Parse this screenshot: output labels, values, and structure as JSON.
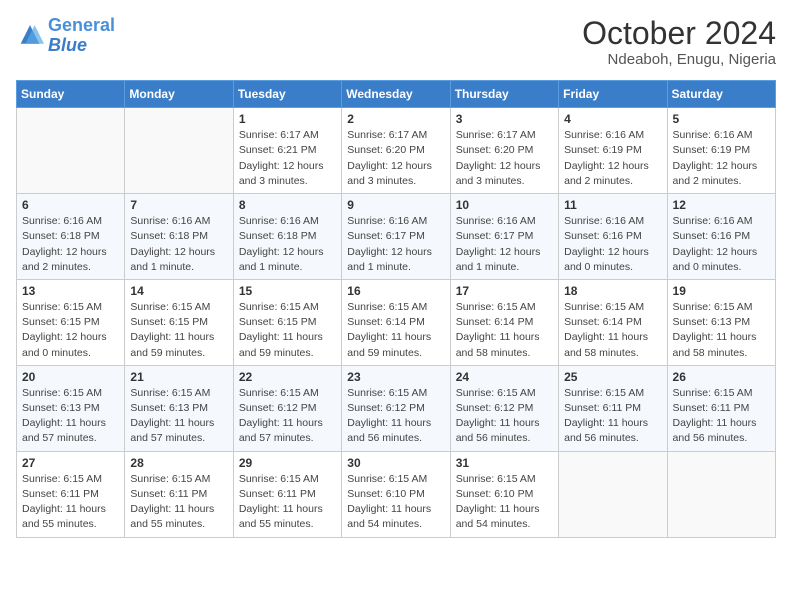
{
  "header": {
    "logo_line1": "General",
    "logo_line2": "Blue",
    "title": "October 2024",
    "subtitle": "Ndeaboh, Enugu, Nigeria"
  },
  "weekdays": [
    "Sunday",
    "Monday",
    "Tuesday",
    "Wednesday",
    "Thursday",
    "Friday",
    "Saturday"
  ],
  "weeks": [
    [
      {
        "day": "",
        "info": ""
      },
      {
        "day": "",
        "info": ""
      },
      {
        "day": "1",
        "info": "Sunrise: 6:17 AM\nSunset: 6:21 PM\nDaylight: 12 hours\nand 3 minutes."
      },
      {
        "day": "2",
        "info": "Sunrise: 6:17 AM\nSunset: 6:20 PM\nDaylight: 12 hours\nand 3 minutes."
      },
      {
        "day": "3",
        "info": "Sunrise: 6:17 AM\nSunset: 6:20 PM\nDaylight: 12 hours\nand 3 minutes."
      },
      {
        "day": "4",
        "info": "Sunrise: 6:16 AM\nSunset: 6:19 PM\nDaylight: 12 hours\nand 2 minutes."
      },
      {
        "day": "5",
        "info": "Sunrise: 6:16 AM\nSunset: 6:19 PM\nDaylight: 12 hours\nand 2 minutes."
      }
    ],
    [
      {
        "day": "6",
        "info": "Sunrise: 6:16 AM\nSunset: 6:18 PM\nDaylight: 12 hours\nand 2 minutes."
      },
      {
        "day": "7",
        "info": "Sunrise: 6:16 AM\nSunset: 6:18 PM\nDaylight: 12 hours\nand 1 minute."
      },
      {
        "day": "8",
        "info": "Sunrise: 6:16 AM\nSunset: 6:18 PM\nDaylight: 12 hours\nand 1 minute."
      },
      {
        "day": "9",
        "info": "Sunrise: 6:16 AM\nSunset: 6:17 PM\nDaylight: 12 hours\nand 1 minute."
      },
      {
        "day": "10",
        "info": "Sunrise: 6:16 AM\nSunset: 6:17 PM\nDaylight: 12 hours\nand 1 minute."
      },
      {
        "day": "11",
        "info": "Sunrise: 6:16 AM\nSunset: 6:16 PM\nDaylight: 12 hours\nand 0 minutes."
      },
      {
        "day": "12",
        "info": "Sunrise: 6:16 AM\nSunset: 6:16 PM\nDaylight: 12 hours\nand 0 minutes."
      }
    ],
    [
      {
        "day": "13",
        "info": "Sunrise: 6:15 AM\nSunset: 6:15 PM\nDaylight: 12 hours\nand 0 minutes."
      },
      {
        "day": "14",
        "info": "Sunrise: 6:15 AM\nSunset: 6:15 PM\nDaylight: 11 hours\nand 59 minutes."
      },
      {
        "day": "15",
        "info": "Sunrise: 6:15 AM\nSunset: 6:15 PM\nDaylight: 11 hours\nand 59 minutes."
      },
      {
        "day": "16",
        "info": "Sunrise: 6:15 AM\nSunset: 6:14 PM\nDaylight: 11 hours\nand 59 minutes."
      },
      {
        "day": "17",
        "info": "Sunrise: 6:15 AM\nSunset: 6:14 PM\nDaylight: 11 hours\nand 58 minutes."
      },
      {
        "day": "18",
        "info": "Sunrise: 6:15 AM\nSunset: 6:14 PM\nDaylight: 11 hours\nand 58 minutes."
      },
      {
        "day": "19",
        "info": "Sunrise: 6:15 AM\nSunset: 6:13 PM\nDaylight: 11 hours\nand 58 minutes."
      }
    ],
    [
      {
        "day": "20",
        "info": "Sunrise: 6:15 AM\nSunset: 6:13 PM\nDaylight: 11 hours\nand 57 minutes."
      },
      {
        "day": "21",
        "info": "Sunrise: 6:15 AM\nSunset: 6:13 PM\nDaylight: 11 hours\nand 57 minutes."
      },
      {
        "day": "22",
        "info": "Sunrise: 6:15 AM\nSunset: 6:12 PM\nDaylight: 11 hours\nand 57 minutes."
      },
      {
        "day": "23",
        "info": "Sunrise: 6:15 AM\nSunset: 6:12 PM\nDaylight: 11 hours\nand 56 minutes."
      },
      {
        "day": "24",
        "info": "Sunrise: 6:15 AM\nSunset: 6:12 PM\nDaylight: 11 hours\nand 56 minutes."
      },
      {
        "day": "25",
        "info": "Sunrise: 6:15 AM\nSunset: 6:11 PM\nDaylight: 11 hours\nand 56 minutes."
      },
      {
        "day": "26",
        "info": "Sunrise: 6:15 AM\nSunset: 6:11 PM\nDaylight: 11 hours\nand 56 minutes."
      }
    ],
    [
      {
        "day": "27",
        "info": "Sunrise: 6:15 AM\nSunset: 6:11 PM\nDaylight: 11 hours\nand 55 minutes."
      },
      {
        "day": "28",
        "info": "Sunrise: 6:15 AM\nSunset: 6:11 PM\nDaylight: 11 hours\nand 55 minutes."
      },
      {
        "day": "29",
        "info": "Sunrise: 6:15 AM\nSunset: 6:11 PM\nDaylight: 11 hours\nand 55 minutes."
      },
      {
        "day": "30",
        "info": "Sunrise: 6:15 AM\nSunset: 6:10 PM\nDaylight: 11 hours\nand 54 minutes."
      },
      {
        "day": "31",
        "info": "Sunrise: 6:15 AM\nSunset: 6:10 PM\nDaylight: 11 hours\nand 54 minutes."
      },
      {
        "day": "",
        "info": ""
      },
      {
        "day": "",
        "info": ""
      }
    ]
  ]
}
